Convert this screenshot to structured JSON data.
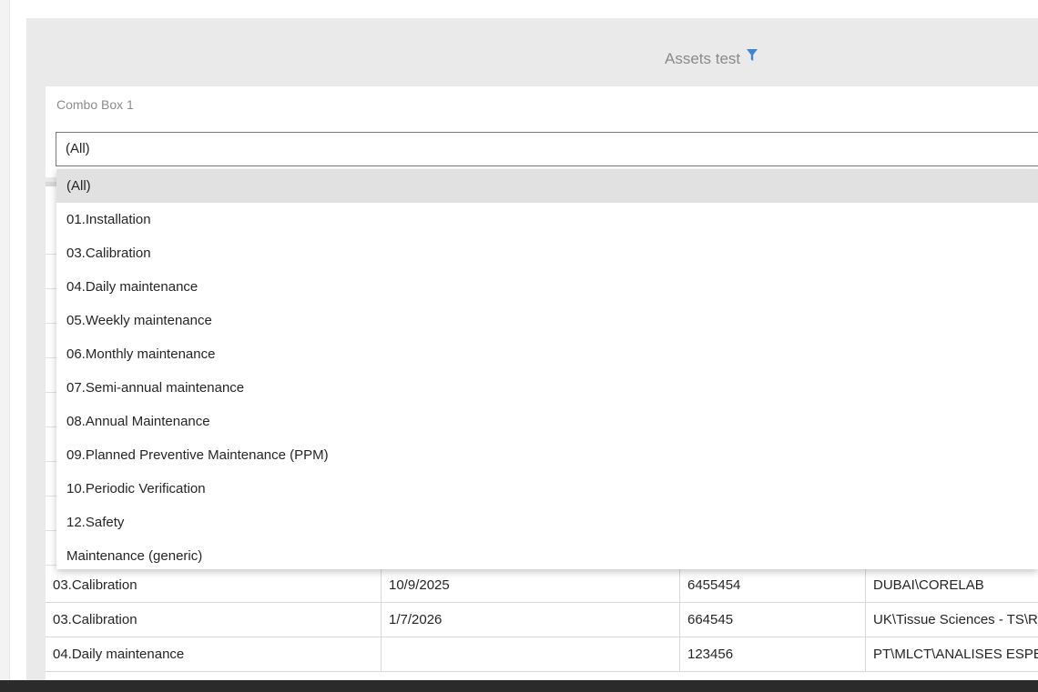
{
  "visual": {
    "title": "Assets test",
    "filter_icon": "funnel-filter-icon",
    "accent_color": "#2e86de"
  },
  "slicer": {
    "title": "Combo Box 1",
    "selected_value": "(All)",
    "options": [
      "(All)",
      "01.Installation",
      "03.Calibration",
      "04.Daily maintenance",
      "05.Weekly maintenance",
      "06.Monthly maintenance",
      "07.Semi-annual maintenance",
      "08.Annual Maintenance",
      "09.Planned Preventive Maintenance (PPM)",
      "10.Periodic Verification",
      "12.Safety",
      "Maintenance (generic)"
    ]
  },
  "table": {
    "rows": [
      {
        "type": "03.Calibration",
        "date": "10/9/2025",
        "id": "6455454",
        "location": "DUBAI\\CORELAB"
      },
      {
        "type": "03.Calibration",
        "date": "1/7/2026",
        "id": "664545",
        "location": "UK\\Tissue Sciences - TS\\Re"
      },
      {
        "type": "04.Daily maintenance",
        "date": "",
        "id": "123456",
        "location": "PT\\MLCT\\ANALISES ESPEC"
      }
    ]
  }
}
